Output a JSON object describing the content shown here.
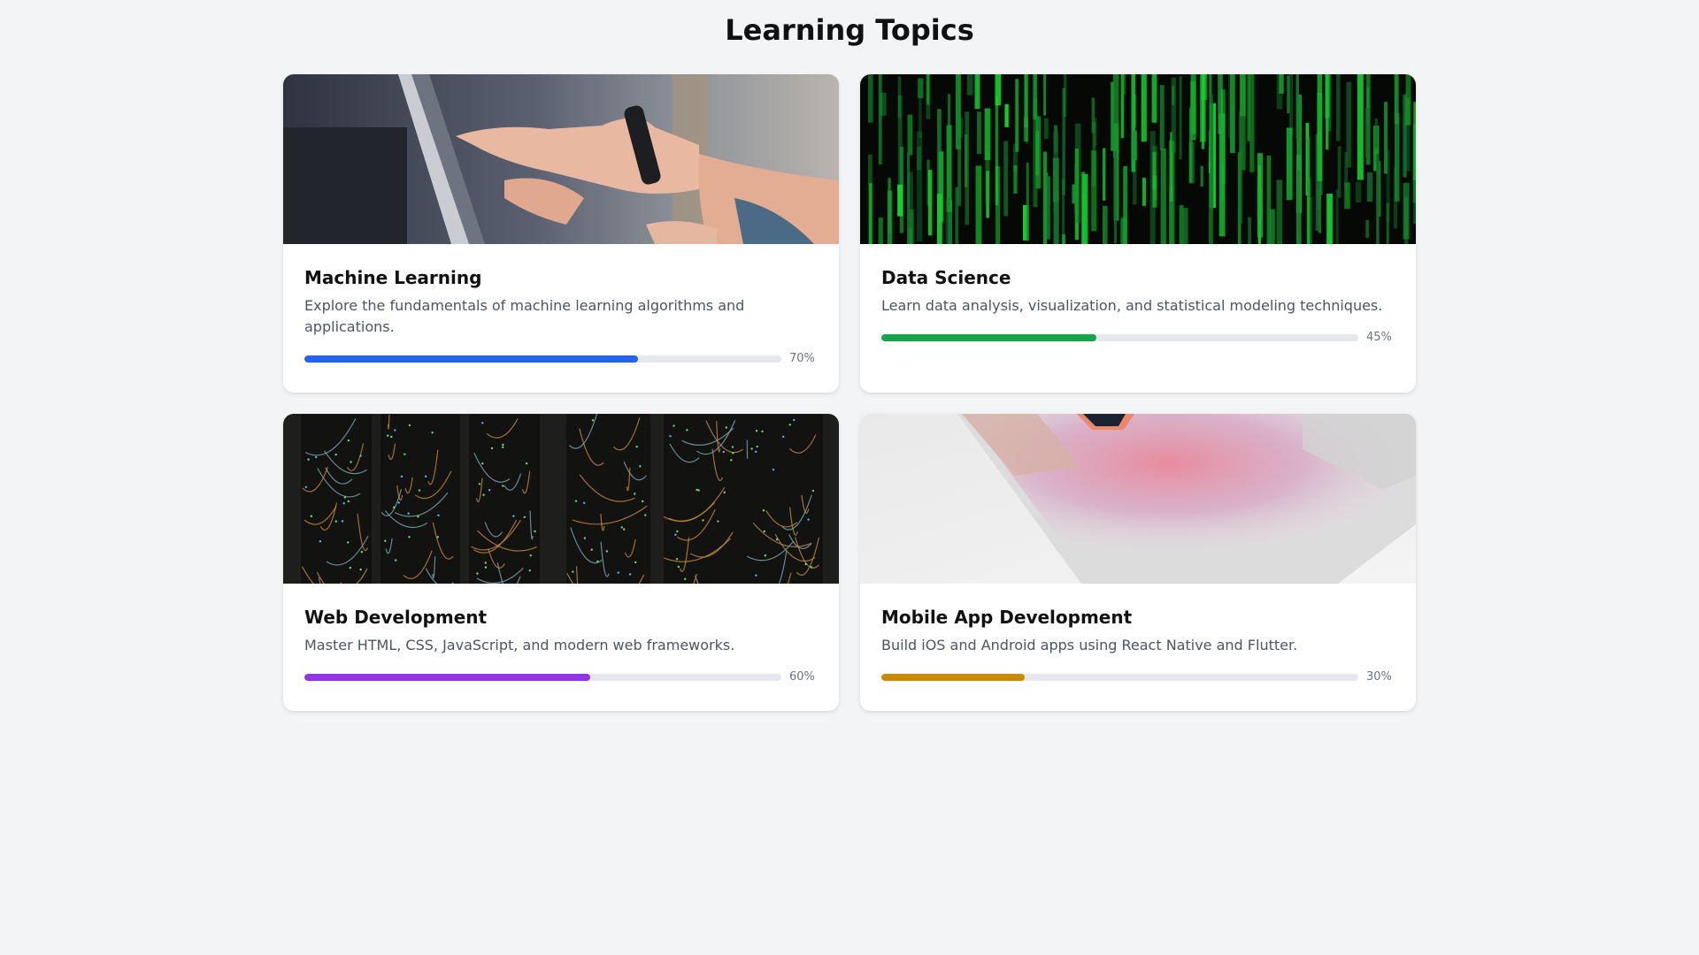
{
  "page": {
    "title": "Learning Topics"
  },
  "topics": [
    {
      "title": "Machine Learning",
      "description": "Explore the fundamentals of machine learning algorithms and applications.",
      "progress": 70,
      "progress_label": "70%",
      "color": "#2563eb",
      "image": "hands-pointing-at-tablet-photo"
    },
    {
      "title": "Data Science",
      "description": "Learn data analysis, visualization, and statistical modeling techniques.",
      "progress": 45,
      "progress_label": "45%",
      "color": "#16a34a",
      "image": "green-matrix-code-photo"
    },
    {
      "title": "Web Development",
      "description": "Master HTML, CSS, JavaScript, and modern web frameworks.",
      "progress": 60,
      "progress_label": "60%",
      "color": "#9333ea",
      "image": "server-rack-cables-photo"
    },
    {
      "title": "Mobile App Development",
      "description": "Build iOS and Android apps using React Native and Flutter.",
      "progress": 30,
      "progress_label": "30%",
      "color": "#ca8a04",
      "image": "laptop-pink-light-photo"
    }
  ]
}
